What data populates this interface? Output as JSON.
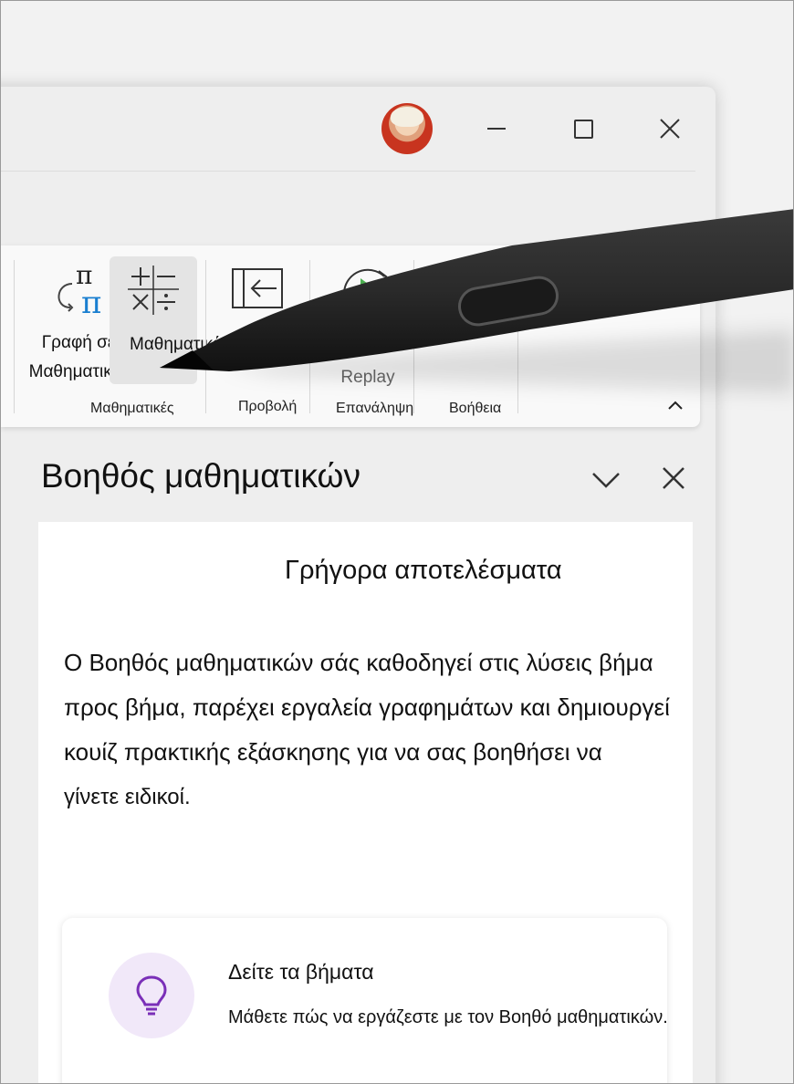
{
  "ribbon": {
    "graph_to_math_label_1": "Γραφή σε",
    "graph_to_math_label_2": "Μαθηματικές",
    "math_label": "Μαθηματικές",
    "replay_label": "Replay",
    "groups": {
      "math": "Μαθηματικές",
      "view": "Προβολή",
      "replay": "Επανάληψη",
      "help": "Βοήθεια"
    }
  },
  "pane": {
    "title": "Βοηθός μαθηματικών",
    "quick_results": "Γρήγορα αποτελέσματα",
    "description_lines": [
      "Ο Βοηθός μαθηματικών σάς καθοδηγεί στις λύσεις βήμα",
      "προς βήμα, παρέχει εργαλεία γραφημάτων και δημιουργεί",
      "κουίζ πρακτικής εξάσκησης για να σας βοηθήσει να",
      "γίνετε ειδικοί."
    ],
    "tip": {
      "icon": "lightbulb-icon",
      "title": "Δείτε τα βήματα",
      "text": "Μάθετε πώς να εργάζεστε με τον Βοηθό μαθηματικών."
    }
  },
  "colors": {
    "accent_purple": "#7a2fb8",
    "tip_icon_bg": "#f1e8f9",
    "replay_green": "#4caf50"
  }
}
